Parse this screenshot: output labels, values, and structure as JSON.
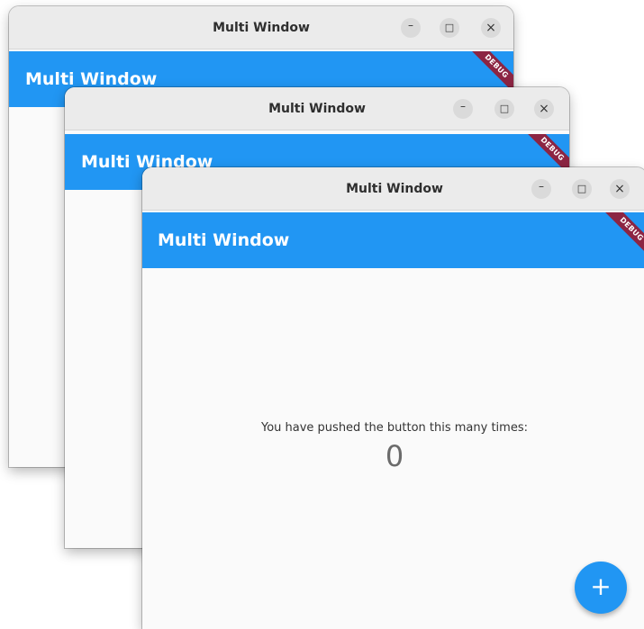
{
  "windows": [
    {
      "title": "Multi Window",
      "app_title": "Multi Window",
      "debug_label": "DEBUG",
      "controls": {
        "minimize": "–",
        "maximize": "□",
        "close": "×"
      }
    },
    {
      "title": "Multi Window",
      "app_title": "Multi Window",
      "debug_label": "DEBUG",
      "controls": {
        "minimize": "–",
        "maximize": "□",
        "close": "×"
      }
    },
    {
      "title": "Multi Window",
      "app_title": "Multi Window",
      "debug_label": "DEBUG",
      "controls": {
        "minimize": "–",
        "maximize": "□",
        "close": "×"
      },
      "counter_label": "You have pushed the button this many times:",
      "counter_value": "0",
      "fab_icon": "+"
    }
  ],
  "colors": {
    "app_bar": "#2196f3",
    "debug_banner": "#8c2543",
    "fab": "#2196f3"
  },
  "icons": [
    "minimize-icon",
    "maximize-icon",
    "close-icon",
    "add-icon"
  ]
}
